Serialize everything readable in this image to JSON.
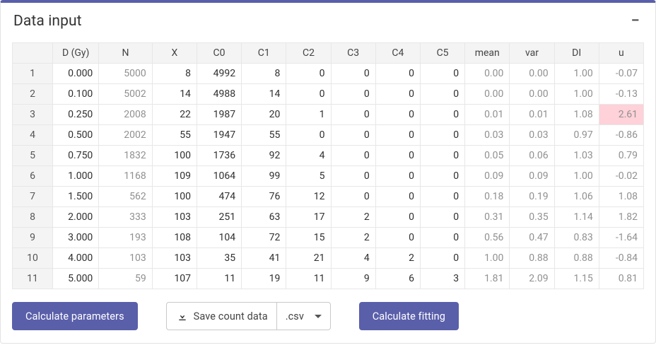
{
  "panel": {
    "title": "Data input",
    "collapse_glyph": "−"
  },
  "table": {
    "headers": [
      "",
      "D (Gy)",
      "N",
      "X",
      "C0",
      "C1",
      "C2",
      "C3",
      "C4",
      "C5",
      "mean",
      "var",
      "DI",
      "u"
    ],
    "muted_cols": [
      2,
      10,
      11,
      12,
      13
    ],
    "rows": [
      {
        "num": "1",
        "cells": [
          "0.000",
          "5000",
          "8",
          "4992",
          "8",
          "0",
          "0",
          "0",
          "0",
          "0.00",
          "0.00",
          "1.00",
          "-0.07"
        ]
      },
      {
        "num": "2",
        "cells": [
          "0.100",
          "5002",
          "14",
          "4988",
          "14",
          "0",
          "0",
          "0",
          "0",
          "0.00",
          "0.00",
          "1.00",
          "-0.13"
        ]
      },
      {
        "num": "3",
        "cells": [
          "0.250",
          "2008",
          "22",
          "1987",
          "20",
          "1",
          "0",
          "0",
          "0",
          "0.01",
          "0.01",
          "1.08",
          "2.61"
        ],
        "highlight": {
          "13": "red"
        }
      },
      {
        "num": "4",
        "cells": [
          "0.500",
          "2002",
          "55",
          "1947",
          "55",
          "0",
          "0",
          "0",
          "0",
          "0.03",
          "0.03",
          "0.97",
          "-0.86"
        ]
      },
      {
        "num": "5",
        "cells": [
          "0.750",
          "1832",
          "100",
          "1736",
          "92",
          "4",
          "0",
          "0",
          "0",
          "0.05",
          "0.06",
          "1.03",
          "0.79"
        ]
      },
      {
        "num": "6",
        "cells": [
          "1.000",
          "1168",
          "109",
          "1064",
          "99",
          "5",
          "0",
          "0",
          "0",
          "0.09",
          "0.09",
          "1.00",
          "-0.02"
        ]
      },
      {
        "num": "7",
        "cells": [
          "1.500",
          "562",
          "100",
          "474",
          "76",
          "12",
          "0",
          "0",
          "0",
          "0.18",
          "0.19",
          "1.06",
          "1.08"
        ]
      },
      {
        "num": "8",
        "cells": [
          "2.000",
          "333",
          "103",
          "251",
          "63",
          "17",
          "2",
          "0",
          "0",
          "0.31",
          "0.35",
          "1.14",
          "1.82"
        ]
      },
      {
        "num": "9",
        "cells": [
          "3.000",
          "193",
          "108",
          "104",
          "72",
          "15",
          "2",
          "0",
          "0",
          "0.56",
          "0.47",
          "0.83",
          "-1.64"
        ]
      },
      {
        "num": "10",
        "cells": [
          "4.000",
          "103",
          "103",
          "35",
          "41",
          "21",
          "4",
          "2",
          "0",
          "1.00",
          "0.88",
          "0.88",
          "-0.84"
        ]
      },
      {
        "num": "11",
        "cells": [
          "5.000",
          "59",
          "107",
          "11",
          "19",
          "11",
          "9",
          "6",
          "3",
          "1.81",
          "2.09",
          "1.15",
          "0.81"
        ]
      }
    ]
  },
  "actions": {
    "calculate_params": "Calculate parameters",
    "save_count_data": "Save count data",
    "format_selected": ".csv",
    "calculate_fitting": "Calculate fitting"
  }
}
